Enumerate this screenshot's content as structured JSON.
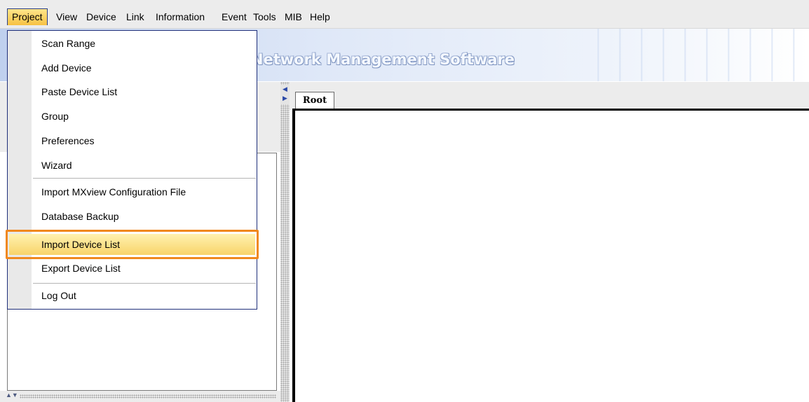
{
  "menubar": {
    "items": [
      "Project",
      "View",
      "Device",
      "Link",
      "Information",
      "Event",
      "Tools",
      "MIB",
      "Help"
    ]
  },
  "banner": {
    "title": "Network Management Software"
  },
  "project_menu": {
    "items": [
      {
        "label": "Scan Range"
      },
      {
        "label": "Add Device"
      },
      {
        "label": "Paste Device List"
      },
      {
        "label": "Group"
      },
      {
        "label": "Preferences"
      },
      {
        "label": "Wizard"
      },
      {
        "label": "Import MXview Configuration File"
      },
      {
        "label": "Database Backup"
      },
      {
        "label": "Import Device List",
        "selected": true
      },
      {
        "label": "Export Device List"
      },
      {
        "label": "Log Out"
      }
    ]
  },
  "topology": {
    "tab_label": "Root"
  },
  "colors": {
    "highlight": "#f0881e",
    "selected_item": "#f8d36a",
    "menu_border": "#1f2f7a"
  }
}
